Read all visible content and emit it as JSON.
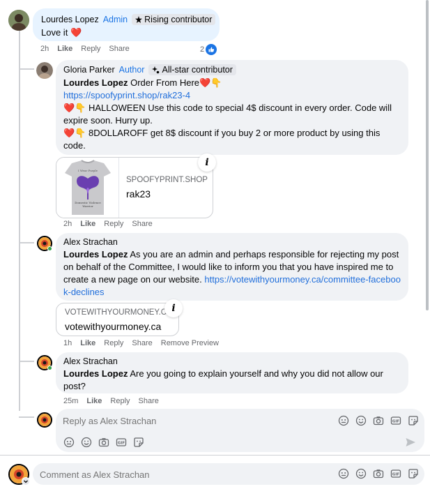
{
  "comments": {
    "c1": {
      "author": "Lourdes Lopez",
      "role": "Admin",
      "badge": "Rising contributor",
      "text": "Love it",
      "heart": "❤️",
      "time": "2h",
      "like": "Like",
      "reply": "Reply",
      "share": "Share",
      "reaction_count": "2"
    },
    "c2": {
      "author": "Gloria Parker",
      "role": "Author",
      "badge": "All-star contributor",
      "mention": "Lourdes Lopez",
      "line1": "Order From Here❤️👇",
      "link": "https://spoofyprint.shop/rak23-4",
      "line3": "❤️👇 HALLOWEEN Use this code to special 4$ discount in every order. Code will expire soon. Hurry up.",
      "line4": "❤️👇 8DOLLAROFF get 8$ discount if you buy 2 or more product by using this code.",
      "preview_domain": "SPOOFYPRINT.SHOP",
      "preview_title": "rak23",
      "time": "2h",
      "like": "Like",
      "reply": "Reply",
      "share": "Share"
    },
    "c3": {
      "author": "Alex Strachan",
      "mention": "Lourdes Lopez",
      "text": "As you are an admin and perhaps responsible for rejecting my post on behalf of the Committee, I would like to inform you that you have inspired me to create a new page on our website.",
      "link": "https://votewithyourmoney.ca/committee-facebook-declines",
      "preview_domain": "VOTEWITHYOURMONEY.C...",
      "preview_title": "votewithyourmoney.ca",
      "time": "1h",
      "like": "Like",
      "reply": "Reply",
      "share": "Share",
      "remove_preview": "Remove Preview"
    },
    "c4": {
      "author": "Alex Strachan",
      "mention": "Lourdes Lopez",
      "text": "Are you going to explain yourself and why you did not allow our post?",
      "time": "25m",
      "like": "Like",
      "reply": "Reply",
      "share": "Share"
    }
  },
  "reply_composer": {
    "placeholder": "Reply as Alex Strachan"
  },
  "comment_composer": {
    "placeholder": "Comment as Alex Strachan"
  },
  "icons": [
    "avatar-icon",
    "emoji-icon",
    "camera-icon",
    "gif-icon",
    "sticker-icon",
    "send-icon",
    "like-reaction-icon",
    "info-icon",
    "star-icon",
    "sparkle-icon"
  ],
  "colors": {
    "accent": "#1b74e4",
    "bubble": "#f0f2f5",
    "highlight_bubble": "#e7f3ff",
    "link": "#216fdb"
  }
}
